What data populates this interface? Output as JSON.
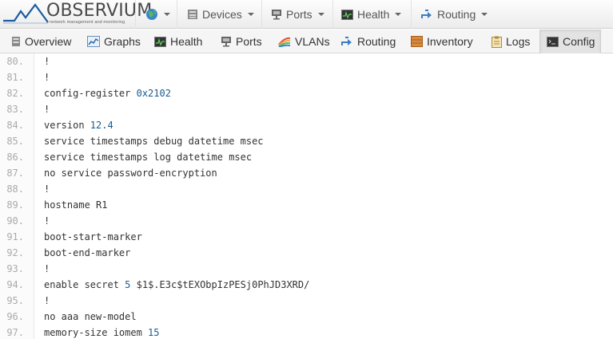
{
  "brand": {
    "name": "OBSERVIUM",
    "tagline": "network management and monitoring",
    "accent": "#1b5c9e"
  },
  "navbar": {
    "globe_icon": "globe-icon",
    "items": [
      {
        "label": "Devices",
        "icon": "server-icon"
      },
      {
        "label": "Ports",
        "icon": "network-port-icon"
      },
      {
        "label": "Health",
        "icon": "health-monitor-icon"
      },
      {
        "label": "Routing",
        "icon": "routing-arrows-icon"
      }
    ]
  },
  "tabs": [
    {
      "label": "Overview",
      "icon": "server-icon",
      "active": false
    },
    {
      "label": "Graphs",
      "icon": "graph-icon",
      "active": false
    },
    {
      "label": "Health",
      "icon": "health-monitor-icon",
      "active": false
    },
    {
      "label": "Ports",
      "icon": "network-port-icon",
      "active": false
    },
    {
      "label": "VLANs",
      "icon": "vlan-icon",
      "active": false
    },
    {
      "label": "Routing",
      "icon": "routing-arrows-icon",
      "active": false
    },
    {
      "label": "Inventory",
      "icon": "inventory-box-icon",
      "active": false
    },
    {
      "label": "Logs",
      "icon": "clipboard-icon",
      "active": false
    },
    {
      "label": "Config",
      "icon": "terminal-icon",
      "active": true
    }
  ],
  "config_lines": [
    {
      "n": "80.",
      "text": "!",
      "value": ""
    },
    {
      "n": "81.",
      "text": "!",
      "value": ""
    },
    {
      "n": "82.",
      "text": "config-register ",
      "value": "0x2102"
    },
    {
      "n": "83.",
      "text": "!",
      "value": ""
    },
    {
      "n": "84.",
      "text": "version ",
      "value": "12.4"
    },
    {
      "n": "85.",
      "text": "service timestamps debug datetime msec",
      "value": ""
    },
    {
      "n": "86.",
      "text": "service timestamps log datetime msec",
      "value": ""
    },
    {
      "n": "87.",
      "text": "no service password-encryption",
      "value": ""
    },
    {
      "n": "88.",
      "text": "!",
      "value": ""
    },
    {
      "n": "89.",
      "text": "hostname R1",
      "value": ""
    },
    {
      "n": "90.",
      "text": "!",
      "value": ""
    },
    {
      "n": "91.",
      "text": "boot-start-marker",
      "value": ""
    },
    {
      "n": "92.",
      "text": "boot-end-marker",
      "value": ""
    },
    {
      "n": "93.",
      "text": "!",
      "value": ""
    },
    {
      "n": "94.",
      "text": "enable secret ",
      "value": "5",
      "rest": " $1$.E3c$tEXObpIzPESj0PhJD3XRD/"
    },
    {
      "n": "95.",
      "text": "!",
      "value": ""
    },
    {
      "n": "96.",
      "text": "no aaa new-model",
      "value": ""
    },
    {
      "n": "97.",
      "text": "memory-size iomem ",
      "value": "15"
    }
  ]
}
